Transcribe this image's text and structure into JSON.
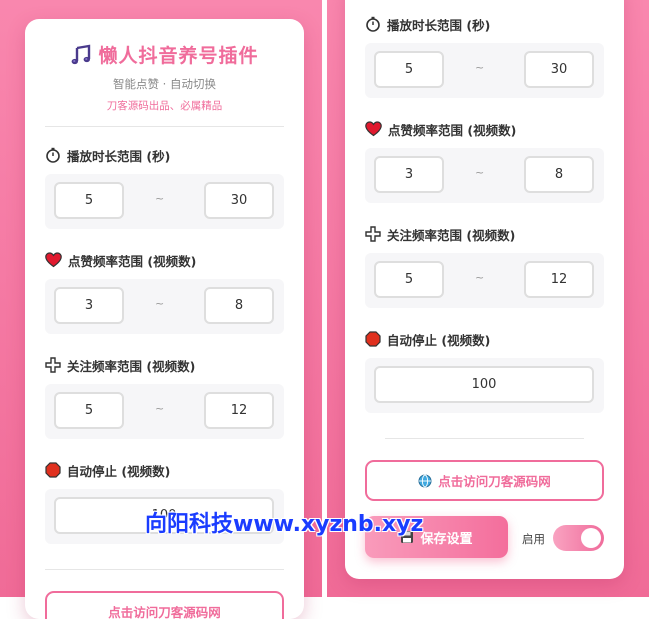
{
  "header": {
    "title": "懒人抖音养号插件",
    "subtitle": "智能点赞 · 自动切换",
    "brand": "刀客源码出品、必属精品"
  },
  "sections": {
    "play": {
      "label": "播放时长范围 (秒)",
      "min": "5",
      "max": "30",
      "icon": "stopwatch-icon"
    },
    "like": {
      "label": "点赞频率范围 (视频数)",
      "min": "3",
      "max": "8",
      "icon": "heart-icon"
    },
    "follow": {
      "label": "关注频率范围 (视频数)",
      "min": "5",
      "max": "12",
      "icon": "plus-icon"
    },
    "stop": {
      "label": "自动停止 (视频数)",
      "value": "100",
      "icon": "stop-icon"
    }
  },
  "range_separator": "~",
  "link_button": {
    "label": "点击访问刀客源码网",
    "icon": "globe-icon"
  },
  "save_button": {
    "label": "保存设置",
    "icon": "floppy-disk-icon"
  },
  "toggle": {
    "label": "启用",
    "on": true
  },
  "watermark": "向阳科技www.xyznb.xyz",
  "colors": {
    "accent": "#f06c9b",
    "background": "#f57aa4",
    "watermark": "#1a3cff"
  }
}
